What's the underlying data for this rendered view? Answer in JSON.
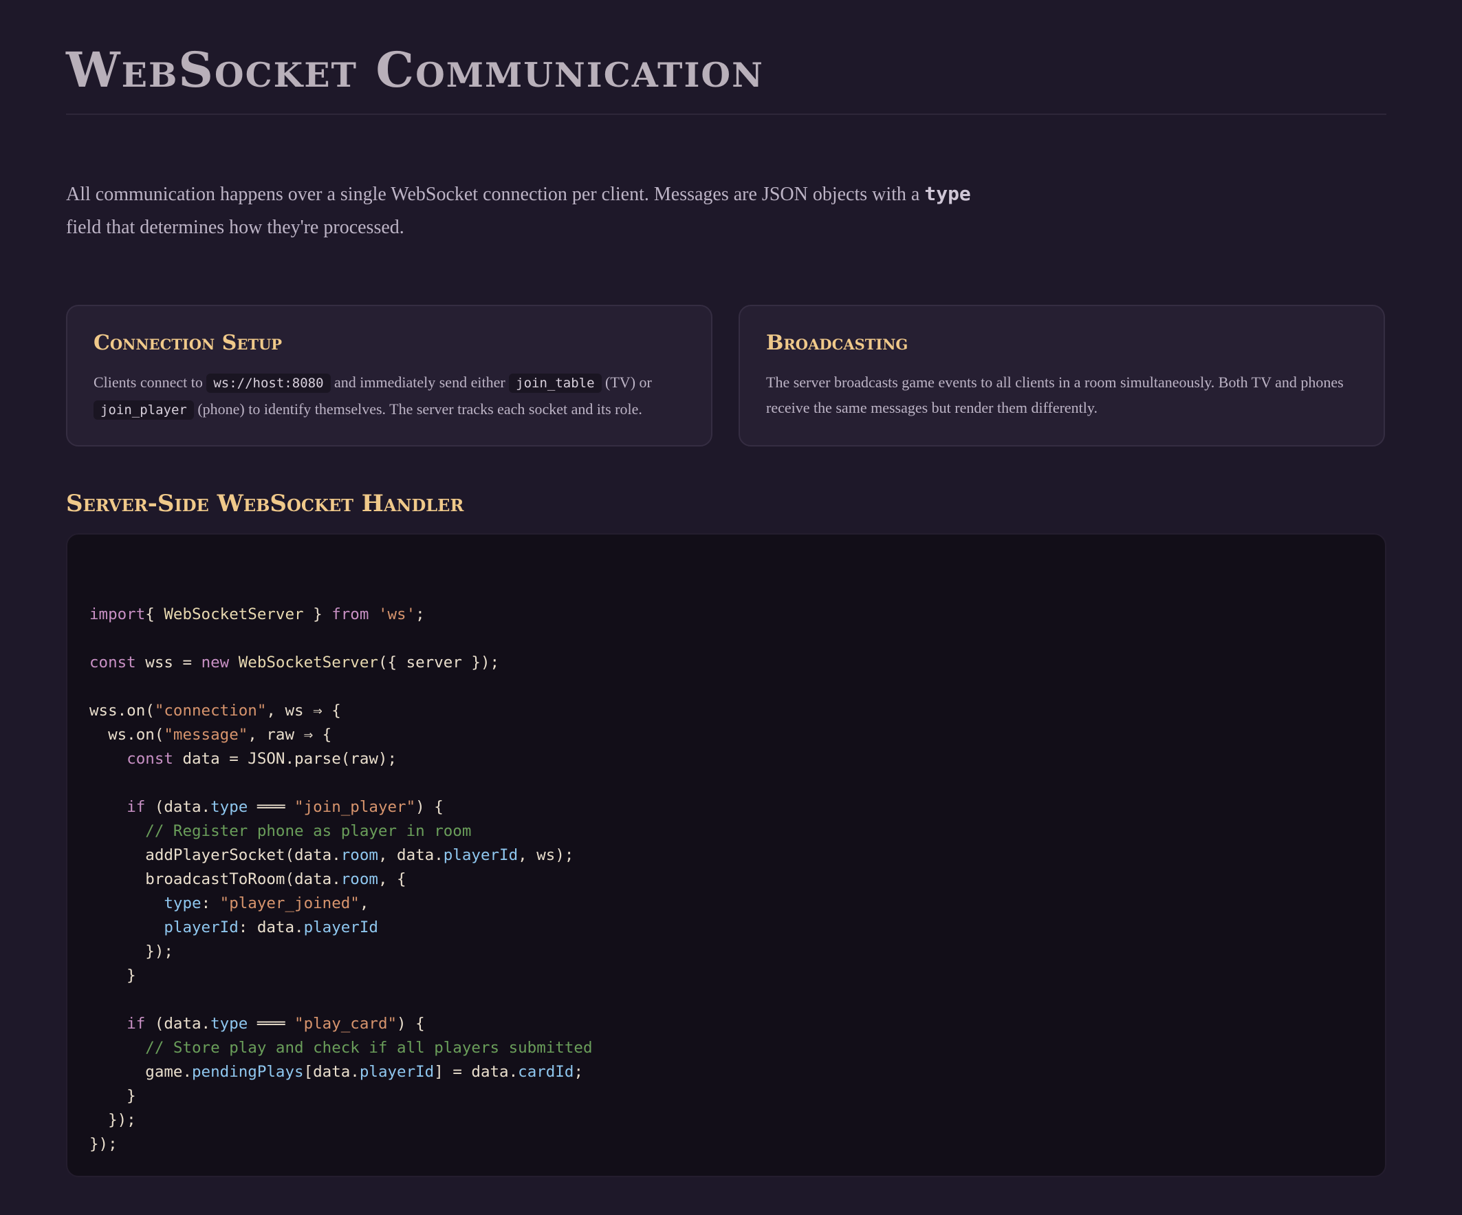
{
  "page": {
    "title": "WebSocket Communication",
    "intro": {
      "text_before": "All communication happens over a single WebSocket connection per client. Messages are JSON objects with a ",
      "code": "type",
      "text_after": " field that determines how they're processed."
    }
  },
  "cards": {
    "connection_setup": {
      "title": "Connection Setup",
      "text_1": "Clients connect to ",
      "code_1": "ws://host:8080",
      "text_2": " and immediately send either ",
      "code_2": "join_table",
      "text_3": " (TV) or ",
      "code_3": "join_player",
      "text_4": " (phone) to identify themselves. The server tracks each socket and its role."
    },
    "broadcasting": {
      "title": "Broadcasting",
      "text": "The server broadcasts game events to all clients in a room simultaneously. Both TV and phones receive the same messages but render them differently."
    }
  },
  "code_section": {
    "title": "Server-Side WebSocket Handler",
    "lines": [
      [],
      [
        [
          "kw",
          "import"
        ],
        [
          "",
          "{ "
        ],
        [
          "fn",
          "WebSocketServer"
        ],
        [
          "",
          " } "
        ],
        [
          "kw",
          "from"
        ],
        [
          "",
          " "
        ],
        [
          "str",
          "'ws'"
        ],
        [
          "",
          ";"
        ]
      ],
      [],
      [
        [
          "kw",
          "const"
        ],
        [
          "",
          " wss = "
        ],
        [
          "kw",
          "new"
        ],
        [
          "",
          " "
        ],
        [
          "fn",
          "WebSocketServer"
        ],
        [
          "",
          "({ server });"
        ]
      ],
      [],
      [
        [
          "",
          "wss.on("
        ],
        [
          "str",
          "\"connection\""
        ],
        [
          "",
          ", ws ⇒ {"
        ]
      ],
      [
        [
          "",
          "  ws.on("
        ],
        [
          "str",
          "\"message\""
        ],
        [
          "",
          ", raw ⇒ {"
        ]
      ],
      [
        [
          "",
          "    "
        ],
        [
          "kw",
          "const"
        ],
        [
          "",
          " data = JSON.parse(raw);"
        ]
      ],
      [],
      [
        [
          "",
          "    "
        ],
        [
          "kw",
          "if"
        ],
        [
          "",
          " (data."
        ],
        [
          "prop",
          "type"
        ],
        [
          "",
          " ═══ "
        ],
        [
          "str",
          "\"join_player\""
        ],
        [
          "",
          ") {"
        ]
      ],
      [
        [
          "",
          "      "
        ],
        [
          "cmt",
          "// Register phone as player in room"
        ]
      ],
      [
        [
          "",
          "      addPlayerSocket(data."
        ],
        [
          "prop",
          "room"
        ],
        [
          "",
          ", data."
        ],
        [
          "prop",
          "playerId"
        ],
        [
          "",
          ", ws);"
        ]
      ],
      [
        [
          "",
          "      broadcastToRoom(data."
        ],
        [
          "prop",
          "room"
        ],
        [
          "",
          ", {"
        ]
      ],
      [
        [
          "",
          "        "
        ],
        [
          "prop",
          "type"
        ],
        [
          "",
          ": "
        ],
        [
          "str",
          "\"player_joined\""
        ],
        [
          "",
          ","
        ]
      ],
      [
        [
          "",
          "        "
        ],
        [
          "prop",
          "playerId"
        ],
        [
          "",
          ": data."
        ],
        [
          "prop",
          "playerId"
        ]
      ],
      [
        [
          "",
          "      });"
        ]
      ],
      [
        [
          "",
          "    }"
        ]
      ],
      [],
      [
        [
          "",
          "    "
        ],
        [
          "kw",
          "if"
        ],
        [
          "",
          " (data."
        ],
        [
          "prop",
          "type"
        ],
        [
          "",
          " ═══ "
        ],
        [
          "str",
          "\"play_card\""
        ],
        [
          "",
          ") {"
        ]
      ],
      [
        [
          "",
          "      "
        ],
        [
          "cmt",
          "// Store play and check if all players submitted"
        ]
      ],
      [
        [
          "",
          "      game."
        ],
        [
          "prop",
          "pendingPlays"
        ],
        [
          "",
          "[data."
        ],
        [
          "prop",
          "playerId"
        ],
        [
          "",
          "] = data."
        ],
        [
          "prop",
          "cardId"
        ],
        [
          "",
          ";"
        ]
      ],
      [
        [
          "",
          "    }"
        ]
      ],
      [
        [
          "",
          "  });"
        ]
      ],
      [
        [
          "",
          "});"
        ]
      ]
    ]
  },
  "colors": {
    "background": "#1e1829",
    "accent": "#f0c98a",
    "card_background": "#261f32",
    "code_background": "#120e18",
    "keyword": "#c890c4",
    "string": "#d7946d",
    "property": "#8fc7ef",
    "comment": "#6a9e5a"
  }
}
